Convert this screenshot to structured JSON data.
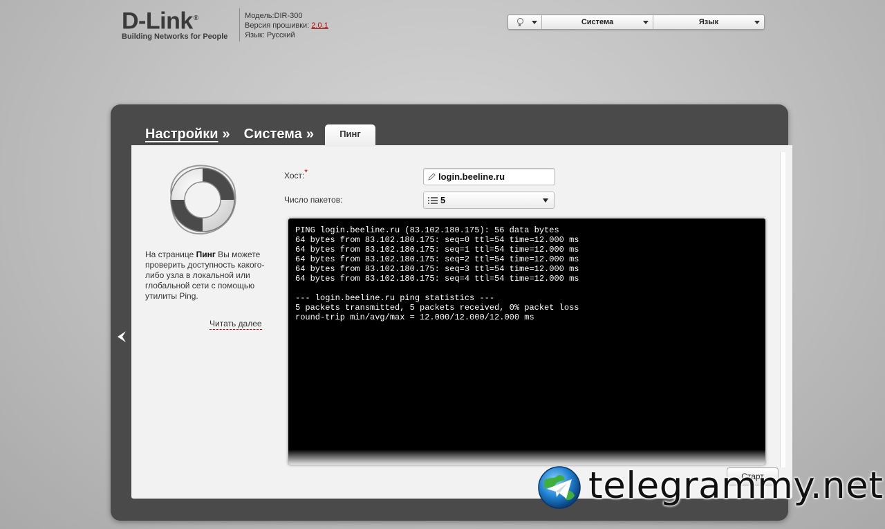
{
  "header": {
    "logo_text": "D-Link",
    "logo_reg": "®",
    "logo_tagline": "Building Networks for People",
    "model_label": "Модель:",
    "model_value": "DIR-300",
    "firmware_label": "Версия прошивки:",
    "firmware_value": "2.0.1",
    "language_label": "Язык:",
    "language_value": "Русский"
  },
  "top_controls": {
    "system_label": "Система",
    "language_label": "Язык"
  },
  "breadcrumb": {
    "items": [
      "Настройки",
      "Система"
    ],
    "separator": "»",
    "active_tab": "Пинг"
  },
  "help": {
    "text_before": "На странице ",
    "text_bold": "Пинг",
    "text_after": " Вы можете проверить доступность какого-либо узла в локальной или глобальной сети с помощью утилиты Ping.",
    "read_more": "Читать далее"
  },
  "form": {
    "host_label": "Хост:",
    "required_mark": "*",
    "host_value": "login.beeline.ru",
    "count_label": "Число пакетов:",
    "count_value": "5"
  },
  "terminal": {
    "lines": [
      "PING login.beeline.ru (83.102.180.175): 56 data bytes",
      "64 bytes from 83.102.180.175: seq=0 ttl=54 time=12.000 ms",
      "64 bytes from 83.102.180.175: seq=1 ttl=54 time=12.000 ms",
      "64 bytes from 83.102.180.175: seq=2 ttl=54 time=12.000 ms",
      "64 bytes from 83.102.180.175: seq=3 ttl=54 time=12.000 ms",
      "64 bytes from 83.102.180.175: seq=4 ttl=54 time=12.000 ms",
      "",
      "--- login.beeline.ru ping statistics ---",
      "5 packets transmitted, 5 packets received, 0% packet loss",
      "round-trip min/avg/max = 12.000/12.000/12.000 ms"
    ]
  },
  "actions": {
    "start_label": "Старт"
  },
  "watermark": {
    "text": "telegrammy.net"
  },
  "colors": {
    "frame": "#4a4a4a",
    "panel": "#f2f2f2",
    "terminal_bg": "#000000",
    "required": "#c00000",
    "link_red": "#b00000"
  }
}
